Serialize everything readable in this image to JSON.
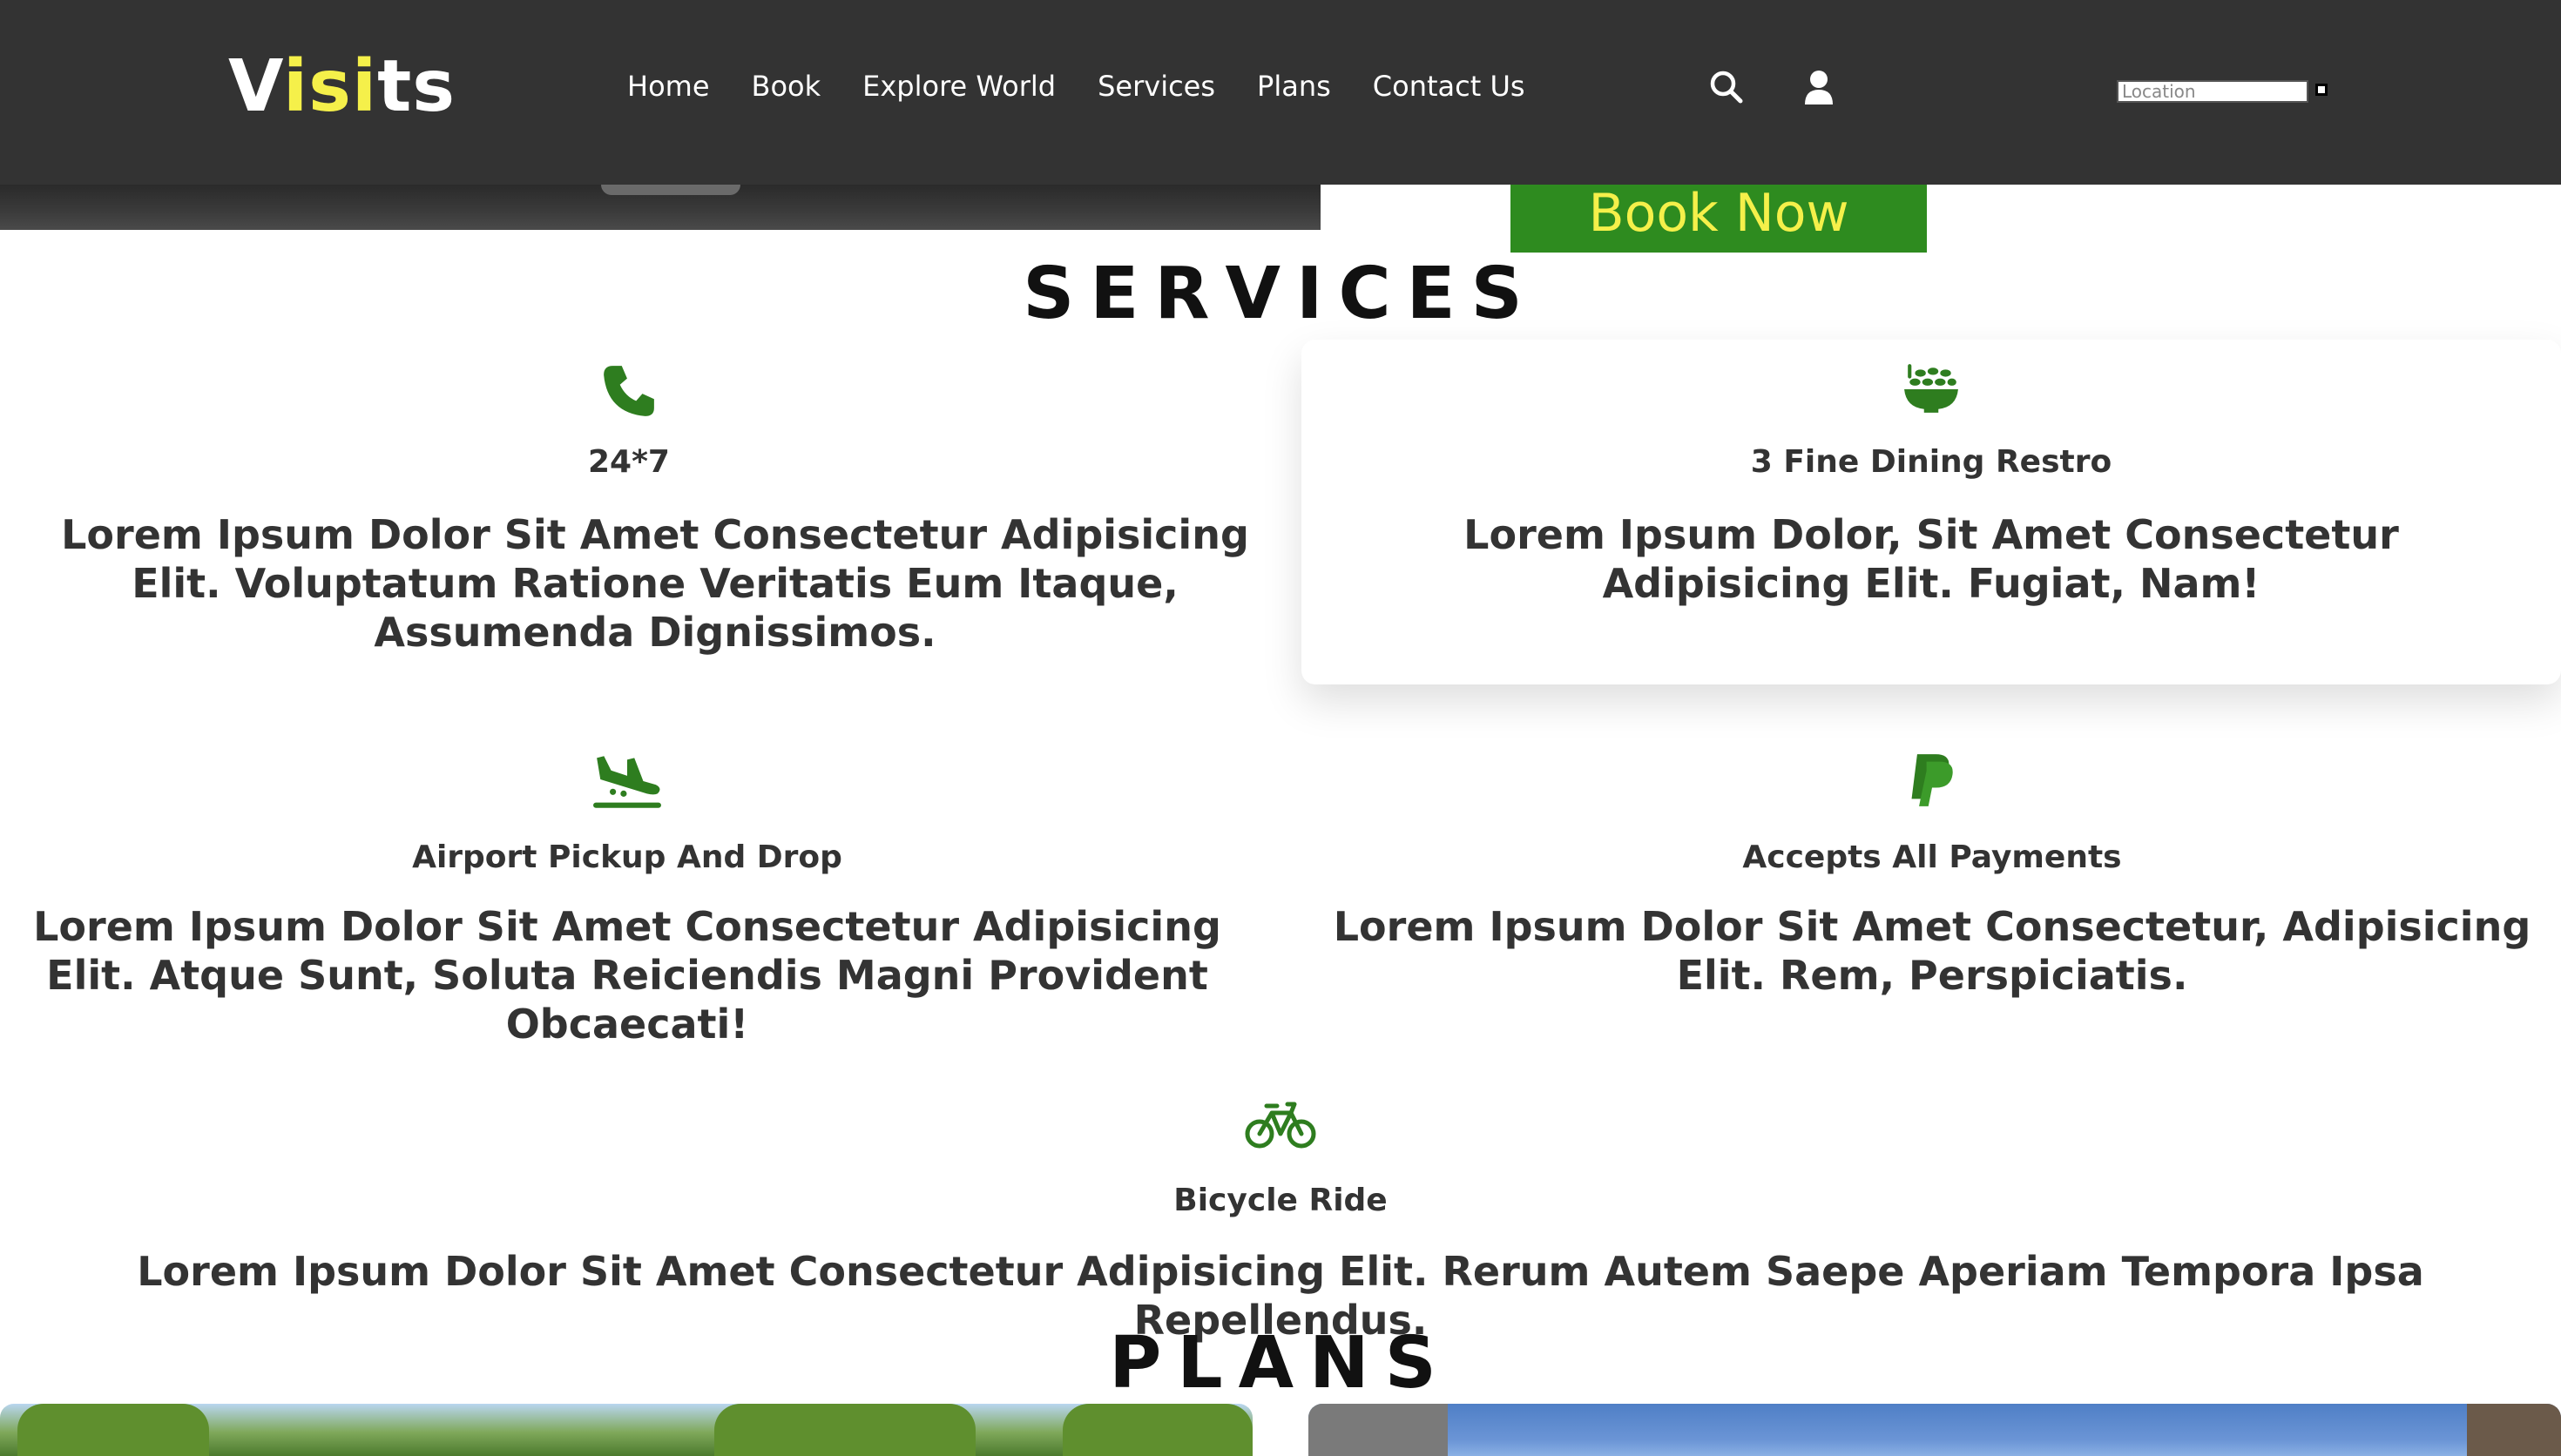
{
  "brand": {
    "logo_first": "V",
    "logo_highlight": "isi",
    "logo_last": "ts"
  },
  "nav": {
    "links": [
      "Home",
      "Book",
      "Explore World",
      "Services",
      "Plans",
      "Contact Us"
    ],
    "location_placeholder": "Location"
  },
  "hero": {
    "book_now_label": "Book Now"
  },
  "services": {
    "heading": "SERVICES",
    "items": [
      {
        "icon": "phone-icon",
        "title": "24*7",
        "desc": "Lorem Ipsum Dolor Sit Amet Consectetur Adipisicing Elit. Voluptatum Ratione Veritatis Eum Itaque, Assumenda Dignissimos."
      },
      {
        "icon": "dining-bowl-icon",
        "title": "3 Fine Dining Restro",
        "desc": "Lorem Ipsum Dolor, Sit Amet Consectetur Adipisicing Elit. Fugiat, Nam!"
      },
      {
        "icon": "plane-arrival-icon",
        "title": "Airport Pickup And Drop",
        "desc": "Lorem Ipsum Dolor Sit Amet Consectetur Adipisicing Elit. Atque Sunt, Soluta Reiciendis Magni Provident Obcaecati!"
      },
      {
        "icon": "paypal-icon",
        "title": "Accepts All Payments",
        "desc": "Lorem Ipsum Dolor Sit Amet Consectetur, Adipisicing Elit. Rem, Perspiciatis."
      },
      {
        "icon": "bicycle-icon",
        "title": "Bicycle Ride",
        "desc": "Lorem Ipsum Dolor Sit Amet Consectetur Adipisicing Elit. Rerum Autem Saepe Aperiam Tempora Ipsa Repellendus."
      }
    ]
  },
  "plans": {
    "heading": "PLANS"
  },
  "colors": {
    "nav_bg": "#333333",
    "logo_accent": "#f5f04a",
    "icon_green": "#2e7d1f",
    "button_green": "#2e8b1f"
  }
}
